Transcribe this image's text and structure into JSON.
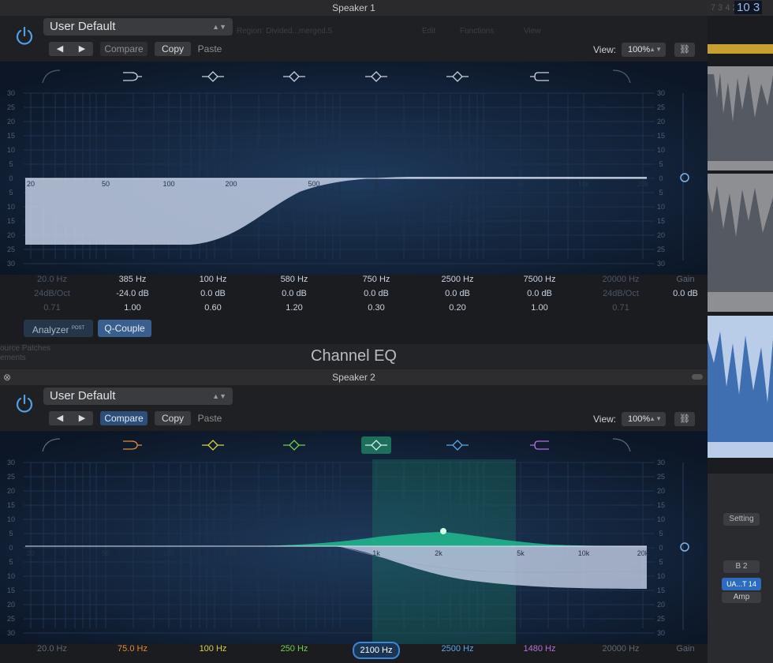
{
  "window1": {
    "title": "Speaker 1",
    "preset": "User Default",
    "compare_label": "Compare",
    "copy_label": "Copy",
    "paste_label": "Paste",
    "view_label": "View:",
    "zoom": "100%",
    "bands": [
      {
        "freq": "20.0 Hz",
        "gain": "24dB/Oct",
        "q": "0.71",
        "enabled": false
      },
      {
        "freq": "385 Hz",
        "gain": "-24.0 dB",
        "q": "1.00",
        "enabled": true
      },
      {
        "freq": "100 Hz",
        "gain": "0.0 dB",
        "q": "0.60",
        "enabled": true
      },
      {
        "freq": "580 Hz",
        "gain": "0.0 dB",
        "q": "1.20",
        "enabled": true
      },
      {
        "freq": "750 Hz",
        "gain": "0.0 dB",
        "q": "0.30",
        "enabled": true
      },
      {
        "freq": "2500 Hz",
        "gain": "0.0 dB",
        "q": "0.20",
        "enabled": true
      },
      {
        "freq": "7500 Hz",
        "gain": "0.0 dB",
        "q": "1.00",
        "enabled": true
      },
      {
        "freq": "20000 Hz",
        "gain": "24dB/Oct",
        "q": "0.71",
        "enabled": false
      }
    ],
    "gain_label": "Gain",
    "gain_value": "0.0 dB",
    "analyzer_label": "Analyzer",
    "analyzer_post": "POST",
    "qcouple_label": "Q-Couple"
  },
  "plugin_name": "Channel EQ",
  "window2": {
    "title": "Speaker 2",
    "preset": "User Default",
    "compare_label": "Compare",
    "copy_label": "Copy",
    "paste_label": "Paste",
    "view_label": "View:",
    "zoom": "100%",
    "bands": [
      {
        "freq": "20.0 Hz",
        "color": "#5b6878"
      },
      {
        "freq": "75.0 Hz",
        "color": "#e08a3a"
      },
      {
        "freq": "100 Hz",
        "color": "#d9d23a"
      },
      {
        "freq": "250 Hz",
        "color": "#6fd04a"
      },
      {
        "freq": "2100 Hz",
        "color": "#ffffff"
      },
      {
        "freq": "2500 Hz",
        "color": "#5aa8e8"
      },
      {
        "freq": "1480 Hz",
        "color": "#b070e0"
      },
      {
        "freq": "20000 Hz",
        "color": "#5b6878"
      }
    ],
    "gain_label": "Gain"
  },
  "freq_ticks": [
    "20",
    "50",
    "100",
    "200",
    "500",
    "1k",
    "2k",
    "5k",
    "10k",
    "20k"
  ],
  "db_scale": [
    "30",
    "25",
    "20",
    "15",
    "10",
    "5",
    "0",
    "5",
    "10",
    "15",
    "20",
    "25",
    "30"
  ],
  "background_text": {
    "region_name": "Region: Divided...merged.5",
    "menu_edit": "Edit",
    "menu_functions": "Functions",
    "menu_view": "View",
    "lcd": "10 3",
    "lcd_small": "7 3 4 28",
    "mixer_setting": "Setting",
    "mixer_bus": "B 2",
    "mixer_insert": "UA...T 14",
    "mixer_amp": "Amp",
    "library_line1": "ource Patches",
    "library_line2": "ements"
  },
  "colors": {
    "accent_blue": "#2c4f7a",
    "eq_fill": "#c8d4ea",
    "eq_green": "#21b48c",
    "graph_bg": "#102038",
    "selected_band_outline": "#3a86d8"
  }
}
